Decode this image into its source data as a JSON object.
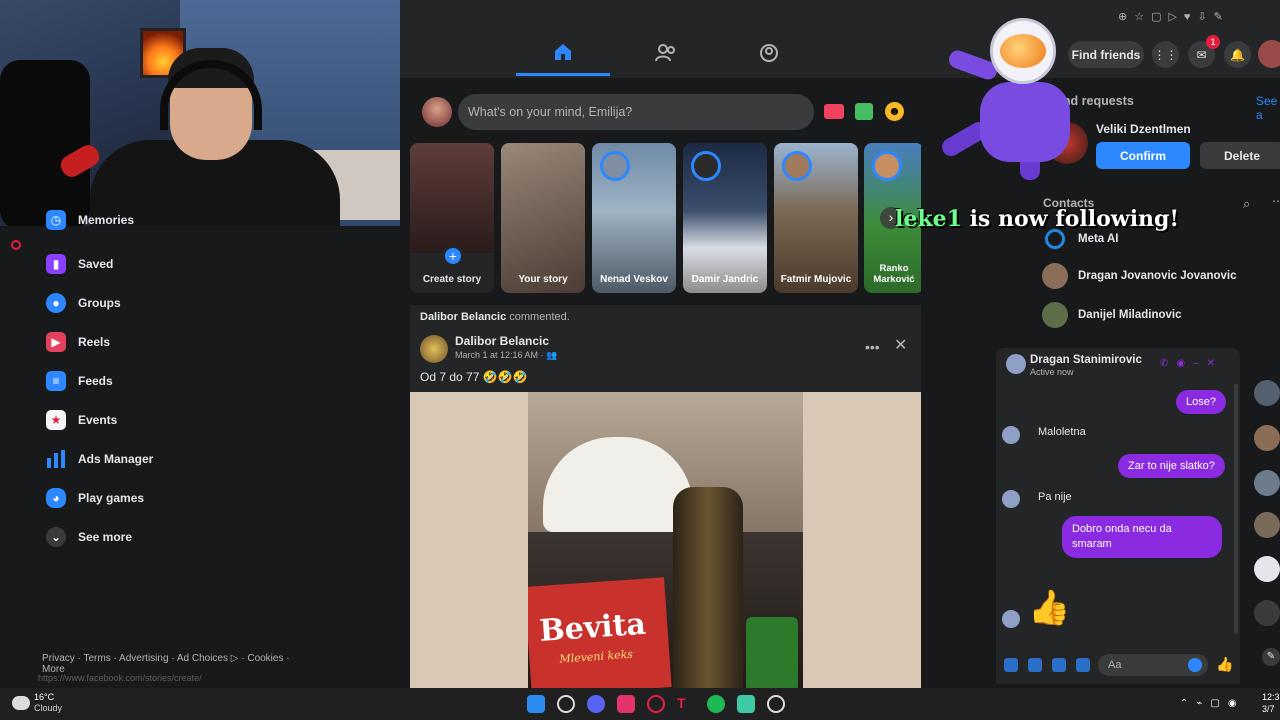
{
  "top_nav": {
    "tabs": [
      {
        "name": "home",
        "icon": "home-icon",
        "active": true
      },
      {
        "name": "friends",
        "icon": "friends-icon",
        "active": false
      },
      {
        "name": "groups",
        "icon": "groups-icon",
        "active": false
      }
    ],
    "find_friends_label": "Find friends",
    "messenger_badge": "1",
    "accent": "#2d88ff"
  },
  "sidebar": {
    "items": [
      {
        "label": "Memories",
        "icon": "memories-icon"
      },
      {
        "label": "Saved",
        "icon": "saved-icon"
      },
      {
        "label": "Groups",
        "icon": "groups-icon"
      },
      {
        "label": "Reels",
        "icon": "reels-icon"
      },
      {
        "label": "Feeds",
        "icon": "feeds-icon"
      },
      {
        "label": "Events",
        "icon": "events-icon"
      },
      {
        "label": "Ads Manager",
        "icon": "ads-manager-icon"
      },
      {
        "label": "Play games",
        "icon": "play-games-icon"
      },
      {
        "label": "See more",
        "icon": "chevron-down-icon"
      }
    ],
    "footer": "Privacy · Terms · Advertising · Ad Choices ▷ · Cookies ·",
    "footer_more": "More",
    "url_hint": "https://www.facebook.com/stories/create/"
  },
  "composer": {
    "placeholder": "What's on your mind, Emilija?"
  },
  "stories": [
    {
      "name": "Create story",
      "kind": "create"
    },
    {
      "name": "Your story",
      "kind": "own"
    },
    {
      "name": "Nenad Veskov",
      "kind": "friend"
    },
    {
      "name": "Damir Jandric",
      "kind": "friend"
    },
    {
      "name": "Fatmir Mujovic",
      "kind": "friend"
    },
    {
      "name": "Ranko Marković",
      "kind": "friend"
    }
  ],
  "post": {
    "activity_actor": "Dalibor Belancic",
    "activity_verb": "commented.",
    "author": "Dalibor Belancic",
    "time": "March 1 at 12:16 AM · ",
    "text": "Od 7 do 77 🤣🤣🤣",
    "image_brand_text": "Bevita",
    "image_brand_sub": "Mleveni keks"
  },
  "right_rail": {
    "friend_requests_title": "Friend requests",
    "see_all": "See a",
    "request_name": "Veliki Dzentlmen",
    "confirm_label": "Confirm",
    "delete_label": "Delete",
    "contacts_title": "Contacts",
    "contacts": [
      {
        "name": "Meta AI"
      },
      {
        "name": "Dragan Jovanovic Jovanovic"
      },
      {
        "name": "Danijel Miladinovic"
      }
    ]
  },
  "overlay": {
    "follower": "leke1",
    "follow_message": " is now following!"
  },
  "chat": {
    "name": "Dragan Stanimirovic",
    "status": "Active now",
    "messages": [
      {
        "from": "me",
        "text": "Lose?"
      },
      {
        "from": "them",
        "text": "Maloletna"
      },
      {
        "from": "me",
        "text": "Zar to nije slatko?"
      },
      {
        "from": "them",
        "text": "Pa nije"
      },
      {
        "from": "me",
        "text": "Dobro onda necu da smaram"
      }
    ],
    "input_placeholder": "Aa",
    "accent": "#8a2be2"
  },
  "taskbar": {
    "temperature": "16°C",
    "condition": "Cloudy",
    "time": "12:3",
    "date": "3/7"
  }
}
